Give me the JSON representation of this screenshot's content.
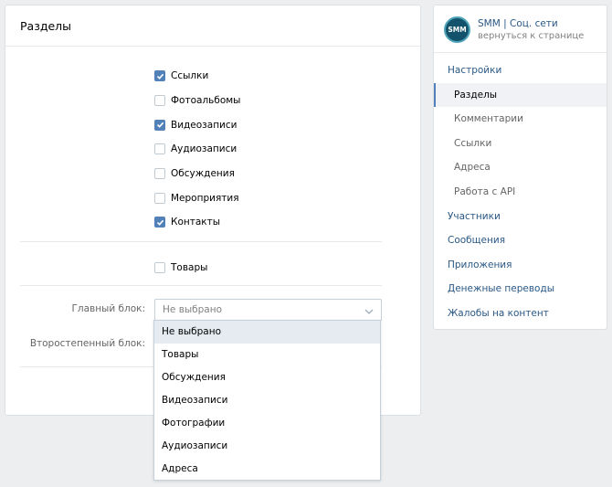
{
  "panel": {
    "title": "Разделы"
  },
  "sections": [
    {
      "label": "Ссылки",
      "checked": true
    },
    {
      "label": "Фотоальбомы",
      "checked": false
    },
    {
      "label": "Видеозаписи",
      "checked": true
    },
    {
      "label": "Аудиозаписи",
      "checked": false
    },
    {
      "label": "Обсуждения",
      "checked": false
    },
    {
      "label": "Мероприятия",
      "checked": false
    },
    {
      "label": "Контакты",
      "checked": true
    }
  ],
  "goods": {
    "label": "Товары",
    "checked": false
  },
  "main_block": {
    "label": "Главный блок:",
    "value": "Не выбрано"
  },
  "secondary_block": {
    "label": "Второстепенный блок:"
  },
  "dropdown_options": [
    "Не выбрано",
    "Товары",
    "Обсуждения",
    "Видеозаписи",
    "Фотографии",
    "Аудиозаписи",
    "Адреса"
  ],
  "sidebar": {
    "avatar_text": "SMM",
    "group_name": "SMM | Соц. сети",
    "back_link": "вернуться к странице",
    "items": [
      {
        "label": "Настройки",
        "sub": false,
        "active": false
      },
      {
        "label": "Разделы",
        "sub": true,
        "active": true
      },
      {
        "label": "Комментарии",
        "sub": true,
        "active": false
      },
      {
        "label": "Ссылки",
        "sub": true,
        "active": false
      },
      {
        "label": "Адреса",
        "sub": true,
        "active": false
      },
      {
        "label": "Работа с API",
        "sub": true,
        "active": false
      },
      {
        "label": "Участники",
        "sub": false,
        "active": false
      },
      {
        "label": "Сообщения",
        "sub": false,
        "active": false
      },
      {
        "label": "Приложения",
        "sub": false,
        "active": false
      },
      {
        "label": "Денежные переводы",
        "sub": false,
        "active": false
      },
      {
        "label": "Жалобы на контент",
        "sub": false,
        "active": false
      }
    ]
  },
  "colors": {
    "accent": "#5181b8",
    "link": "#2a5885",
    "background": "#edeef0"
  }
}
